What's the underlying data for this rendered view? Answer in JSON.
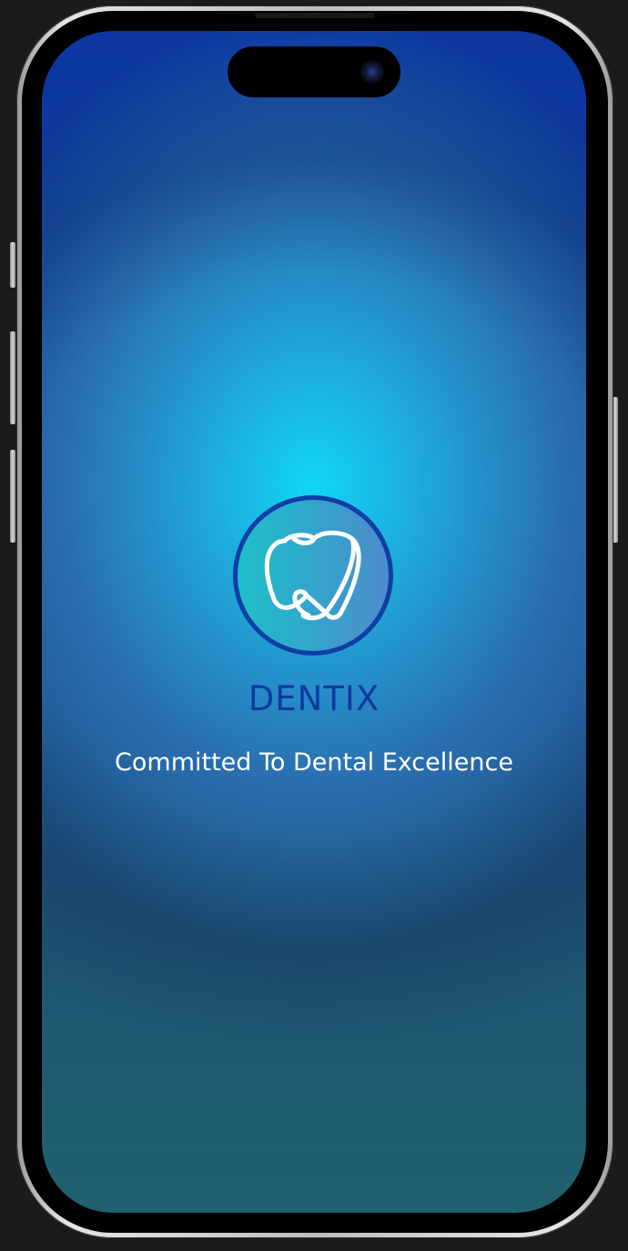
{
  "app": {
    "brand_name": "DENTIX",
    "tagline": "Committed To Dental Excellence"
  },
  "icons": {
    "logo": "tooth-icon"
  },
  "colors": {
    "brand_blue": "#0d3aa0",
    "glow_cyan": "#10d6f0",
    "tagline_text": "#ffffff"
  }
}
